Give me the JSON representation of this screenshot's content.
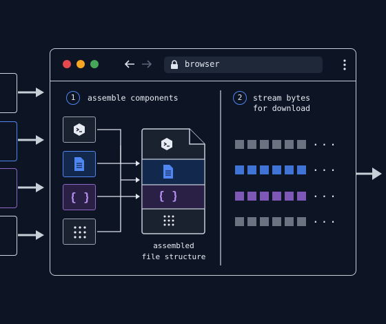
{
  "browser": {
    "url_text": "browser",
    "traffic_light_colors": [
      "#e5484d",
      "#f5a623",
      "#46a758"
    ],
    "icons": [
      "back-arrow-icon",
      "forward-arrow-icon",
      "lock-icon",
      "kebab-menu-icon"
    ]
  },
  "steps": [
    {
      "number": "1",
      "label": "assemble components"
    },
    {
      "number": "2",
      "label": "stream bytes\nfor download"
    }
  ],
  "components": [
    {
      "icon": "terminal-icon",
      "style": "gray"
    },
    {
      "icon": "document-icon",
      "style": "blue"
    },
    {
      "icon": "curly-braces-icon",
      "style": "purple"
    },
    {
      "icon": "grid-dots-icon",
      "style": "gray"
    }
  ],
  "assembled_file": {
    "caption": "assembled\nfile structure",
    "sections": [
      "terminal-icon",
      "document-icon",
      "curly-braces-icon",
      "grid-dots-icon"
    ]
  },
  "byte_rows": [
    {
      "color": "#6b7380",
      "count": 6,
      "ellipsis": "..."
    },
    {
      "color": "#3f74d6",
      "count": 6,
      "ellipsis": "..."
    },
    {
      "color": "#7e58b6",
      "count": 6,
      "ellipsis": "..."
    },
    {
      "color": "#6b7380",
      "count": 6,
      "ellipsis": "..."
    }
  ],
  "colors": {
    "background": "#0d1524",
    "accent_blue": "#4f86f2",
    "accent_purple": "#8e67c8",
    "line": "#c7cfd9"
  }
}
